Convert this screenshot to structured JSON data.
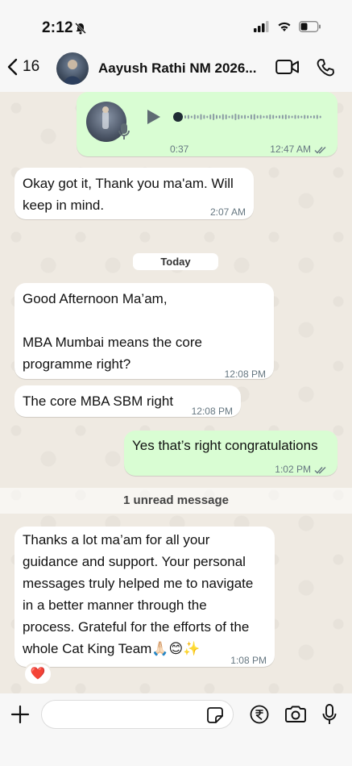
{
  "status_bar": {
    "time": "2:12"
  },
  "header": {
    "back_count": "16",
    "contact_name": "Aayush Rathi NM 2026..."
  },
  "messages": [
    {
      "type": "voice",
      "direction": "out",
      "duration": "0:37",
      "time": "12:47 AM",
      "read": true
    },
    {
      "type": "text",
      "direction": "in",
      "lines": [
        "Okay got it, Thank you ma'am. Will",
        "keep in mind."
      ],
      "time": "2:07 AM"
    },
    {
      "type": "date",
      "label": "Today"
    },
    {
      "type": "text",
      "direction": "in",
      "lines": [
        "Good Afternoon Ma’am,",
        "",
        "MBA Mumbai means the core",
        "programme right?"
      ],
      "time": "12:08 PM"
    },
    {
      "type": "text",
      "direction": "in",
      "lines": [
        "The core MBA SBM right"
      ],
      "time": "12:08 PM"
    },
    {
      "type": "text",
      "direction": "out",
      "lines": [
        "Yes that’s right congratulations"
      ],
      "time": "1:02 PM",
      "read": true
    },
    {
      "type": "unread",
      "label": "1 unread message"
    },
    {
      "type": "text",
      "direction": "in",
      "lines": [
        "Thanks a lot ma’am for all your",
        "guidance and support. Your personal",
        "messages truly helped me to navigate",
        "in a better manner through the",
        "process. Grateful for the efforts of the",
        "whole Cat King Team🙏🏻😊✨"
      ],
      "time": "1:08 PM",
      "reaction": "❤️"
    }
  ],
  "composer": {
    "placeholder": ""
  },
  "colors": {
    "outgoing": "#d9fdd3",
    "incoming": "#ffffff",
    "chat_bg": "#efeae2",
    "read_ticks": "#667781"
  },
  "icons": [
    "back-chevron-icon",
    "video-call-icon",
    "voice-call-icon",
    "play-icon",
    "mic-icon",
    "plus-icon",
    "sticker-icon",
    "rupee-icon",
    "camera-icon"
  ]
}
